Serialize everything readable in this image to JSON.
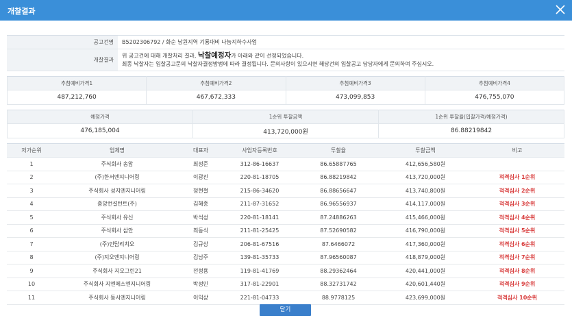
{
  "window": {
    "title": "개찰결과"
  },
  "notice": {
    "label_no": "공고건명",
    "notice_name": "B5202306792 / 화순 남원지역 기룡대비 나눔지하수사업",
    "label_result": "개찰결과",
    "line1_pre": "위 공고건에 대해 개찰처리 결과,",
    "line1_highlight": "낙찰예정자",
    "line1_post": "가 아래와 같이 선정되었습니다.",
    "line2": "최종 낙찰자는 입찰공고문의 낙찰자결정방법에 따라 결정됩니다. 문의사항이 있으시면 해당건의 입찰공고 담당자에게 문의하여 주십시오."
  },
  "prices": [
    {
      "label": "추첨예비가격1",
      "value": "487,212,760"
    },
    {
      "label": "추첨예비가격2",
      "value": "467,672,333"
    },
    {
      "label": "추첨예비가격3",
      "value": "473,099,853"
    },
    {
      "label": "추첨예비가격4",
      "value": "476,755,070"
    }
  ],
  "summary": [
    {
      "label": "예정가격",
      "value": "476,185,004"
    },
    {
      "label": "1순위 투찰금액",
      "value": "413,720,000원"
    },
    {
      "label": "1순위 투찰율(입찰가격/예정가격)",
      "value": "86.88219842"
    }
  ],
  "results": {
    "headers": [
      "저가순위",
      "업체명",
      "대표자",
      "사업자등록번호",
      "투찰율",
      "투찰금액",
      "비고"
    ],
    "rows": [
      [
        "1",
        "주식회사 송암",
        "최성준",
        "312-86-16637",
        "86.65887765",
        "412,656,580원",
        ""
      ],
      [
        "2",
        "(주)한서엔지니어링",
        "이광진",
        "220-81-18705",
        "86.88219842",
        "413,720,000원",
        "적격심사 1순위"
      ],
      [
        "3",
        "주식회사 성지엔지니어링",
        "정현철",
        "215-86-34620",
        "86.88656647",
        "413,740,800원",
        "적격심사 2순위"
      ],
      [
        "4",
        "중앙컨설턴트(주)",
        "김해종",
        "211-87-31652",
        "86.96556937",
        "414,117,000원",
        "적격심사 3순위"
      ],
      [
        "5",
        "주식회사 유신",
        "박석성",
        "220-81-18141",
        "87.24886263",
        "415,466,000원",
        "적격심사 4순위"
      ],
      [
        "6",
        "주식회사 삼안",
        "최동식",
        "211-81-25425",
        "87.52690582",
        "416,790,000원",
        "적격심사 5순위"
      ],
      [
        "7",
        "(주)인탑리치오",
        "김규상",
        "206-81-67516",
        "87.6466072",
        "417,360,000원",
        "적격심사 6순위"
      ],
      [
        "8",
        "(주)지오엔지니어링",
        "김남주",
        "139-81-35733",
        "87.96560087",
        "418,879,000원",
        "적격심사 7순위"
      ],
      [
        "9",
        "주식회사 지오그린21",
        "전정용",
        "119-81-41769",
        "88.29362464",
        "420,441,000원",
        "적격심사 8순위"
      ],
      [
        "10",
        "주식회사 지엔에스엔지니어링",
        "박성민",
        "317-81-22901",
        "88.32731742",
        "420,601,440원",
        "적격심사 9순위"
      ],
      [
        "11",
        "주식회사 동서엔지니어링",
        "이익상",
        "221-81-04733",
        "88.9778125",
        "423,699,000원",
        "적격심사 10순위"
      ]
    ]
  },
  "footer": {
    "close_label": "닫기"
  },
  "colors": {
    "accent": "#3a8fd9",
    "note_red": "#d83c3c",
    "button": "#3a7fcb"
  }
}
